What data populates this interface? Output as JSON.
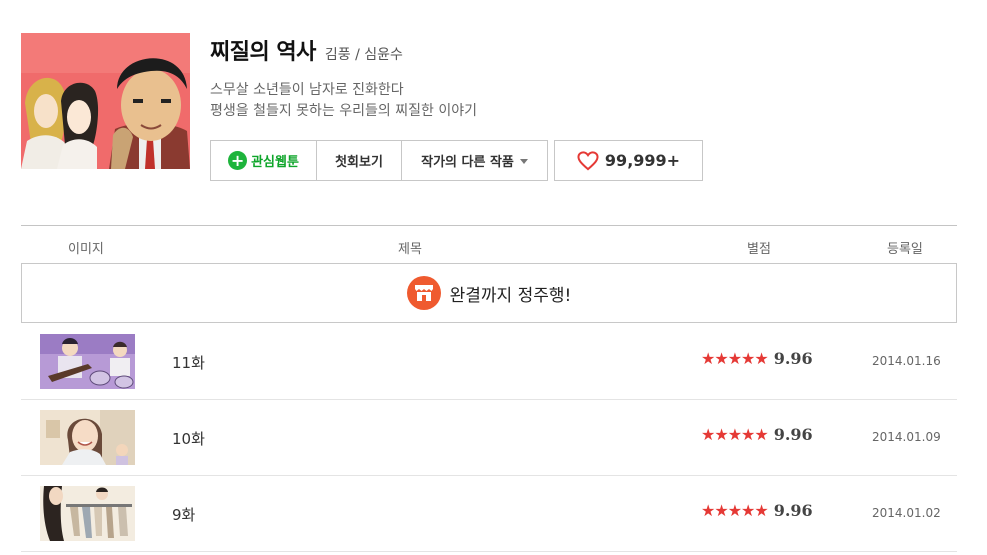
{
  "webtoon": {
    "title": "찌질의 역사",
    "authors": "김풍 / 심윤수",
    "description": [
      "스무살 소년들이 남자로 진화한다",
      "평생을 철들지 못하는 우리들의 찌질한 이야기"
    ]
  },
  "buttons": {
    "favorite": "관심웹툰",
    "first_episode": "첫회보기",
    "other_works": "작가의 다른 작품",
    "likes": "99,999+"
  },
  "table": {
    "headers": {
      "image": "이미지",
      "title": "제목",
      "rating": "별점",
      "date": "등록일"
    },
    "banner": "완결까지 정주행!",
    "rows": [
      {
        "title": "11화",
        "stars": "★★★★★",
        "rating": "9.96",
        "date": "2014.01.16"
      },
      {
        "title": "10화",
        "stars": "★★★★★",
        "rating": "9.96",
        "date": "2014.01.09"
      },
      {
        "title": "9화",
        "stars": "★★★★★",
        "rating": "9.96",
        "date": "2014.01.02"
      }
    ]
  },
  "colors": {
    "accent_green": "#1eb43c",
    "star_red": "#e53935",
    "banner_orange": "#ef5a2f"
  }
}
